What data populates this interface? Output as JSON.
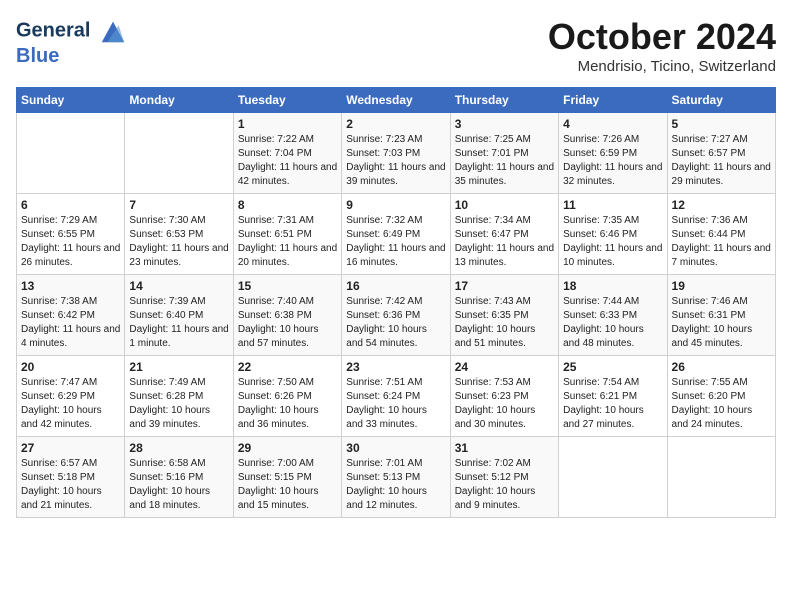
{
  "header": {
    "logo_line1": "General",
    "logo_line2": "Blue",
    "month": "October 2024",
    "location": "Mendrisio, Ticino, Switzerland"
  },
  "days_of_week": [
    "Sunday",
    "Monday",
    "Tuesday",
    "Wednesday",
    "Thursday",
    "Friday",
    "Saturday"
  ],
  "weeks": [
    [
      {
        "day": "",
        "sunrise": "",
        "sunset": "",
        "daylight": ""
      },
      {
        "day": "",
        "sunrise": "",
        "sunset": "",
        "daylight": ""
      },
      {
        "day": "1",
        "sunrise": "Sunrise: 7:22 AM",
        "sunset": "Sunset: 7:04 PM",
        "daylight": "Daylight: 11 hours and 42 minutes."
      },
      {
        "day": "2",
        "sunrise": "Sunrise: 7:23 AM",
        "sunset": "Sunset: 7:03 PM",
        "daylight": "Daylight: 11 hours and 39 minutes."
      },
      {
        "day": "3",
        "sunrise": "Sunrise: 7:25 AM",
        "sunset": "Sunset: 7:01 PM",
        "daylight": "Daylight: 11 hours and 35 minutes."
      },
      {
        "day": "4",
        "sunrise": "Sunrise: 7:26 AM",
        "sunset": "Sunset: 6:59 PM",
        "daylight": "Daylight: 11 hours and 32 minutes."
      },
      {
        "day": "5",
        "sunrise": "Sunrise: 7:27 AM",
        "sunset": "Sunset: 6:57 PM",
        "daylight": "Daylight: 11 hours and 29 minutes."
      }
    ],
    [
      {
        "day": "6",
        "sunrise": "Sunrise: 7:29 AM",
        "sunset": "Sunset: 6:55 PM",
        "daylight": "Daylight: 11 hours and 26 minutes."
      },
      {
        "day": "7",
        "sunrise": "Sunrise: 7:30 AM",
        "sunset": "Sunset: 6:53 PM",
        "daylight": "Daylight: 11 hours and 23 minutes."
      },
      {
        "day": "8",
        "sunrise": "Sunrise: 7:31 AM",
        "sunset": "Sunset: 6:51 PM",
        "daylight": "Daylight: 11 hours and 20 minutes."
      },
      {
        "day": "9",
        "sunrise": "Sunrise: 7:32 AM",
        "sunset": "Sunset: 6:49 PM",
        "daylight": "Daylight: 11 hours and 16 minutes."
      },
      {
        "day": "10",
        "sunrise": "Sunrise: 7:34 AM",
        "sunset": "Sunset: 6:47 PM",
        "daylight": "Daylight: 11 hours and 13 minutes."
      },
      {
        "day": "11",
        "sunrise": "Sunrise: 7:35 AM",
        "sunset": "Sunset: 6:46 PM",
        "daylight": "Daylight: 11 hours and 10 minutes."
      },
      {
        "day": "12",
        "sunrise": "Sunrise: 7:36 AM",
        "sunset": "Sunset: 6:44 PM",
        "daylight": "Daylight: 11 hours and 7 minutes."
      }
    ],
    [
      {
        "day": "13",
        "sunrise": "Sunrise: 7:38 AM",
        "sunset": "Sunset: 6:42 PM",
        "daylight": "Daylight: 11 hours and 4 minutes."
      },
      {
        "day": "14",
        "sunrise": "Sunrise: 7:39 AM",
        "sunset": "Sunset: 6:40 PM",
        "daylight": "Daylight: 11 hours and 1 minute."
      },
      {
        "day": "15",
        "sunrise": "Sunrise: 7:40 AM",
        "sunset": "Sunset: 6:38 PM",
        "daylight": "Daylight: 10 hours and 57 minutes."
      },
      {
        "day": "16",
        "sunrise": "Sunrise: 7:42 AM",
        "sunset": "Sunset: 6:36 PM",
        "daylight": "Daylight: 10 hours and 54 minutes."
      },
      {
        "day": "17",
        "sunrise": "Sunrise: 7:43 AM",
        "sunset": "Sunset: 6:35 PM",
        "daylight": "Daylight: 10 hours and 51 minutes."
      },
      {
        "day": "18",
        "sunrise": "Sunrise: 7:44 AM",
        "sunset": "Sunset: 6:33 PM",
        "daylight": "Daylight: 10 hours and 48 minutes."
      },
      {
        "day": "19",
        "sunrise": "Sunrise: 7:46 AM",
        "sunset": "Sunset: 6:31 PM",
        "daylight": "Daylight: 10 hours and 45 minutes."
      }
    ],
    [
      {
        "day": "20",
        "sunrise": "Sunrise: 7:47 AM",
        "sunset": "Sunset: 6:29 PM",
        "daylight": "Daylight: 10 hours and 42 minutes."
      },
      {
        "day": "21",
        "sunrise": "Sunrise: 7:49 AM",
        "sunset": "Sunset: 6:28 PM",
        "daylight": "Daylight: 10 hours and 39 minutes."
      },
      {
        "day": "22",
        "sunrise": "Sunrise: 7:50 AM",
        "sunset": "Sunset: 6:26 PM",
        "daylight": "Daylight: 10 hours and 36 minutes."
      },
      {
        "day": "23",
        "sunrise": "Sunrise: 7:51 AM",
        "sunset": "Sunset: 6:24 PM",
        "daylight": "Daylight: 10 hours and 33 minutes."
      },
      {
        "day": "24",
        "sunrise": "Sunrise: 7:53 AM",
        "sunset": "Sunset: 6:23 PM",
        "daylight": "Daylight: 10 hours and 30 minutes."
      },
      {
        "day": "25",
        "sunrise": "Sunrise: 7:54 AM",
        "sunset": "Sunset: 6:21 PM",
        "daylight": "Daylight: 10 hours and 27 minutes."
      },
      {
        "day": "26",
        "sunrise": "Sunrise: 7:55 AM",
        "sunset": "Sunset: 6:20 PM",
        "daylight": "Daylight: 10 hours and 24 minutes."
      }
    ],
    [
      {
        "day": "27",
        "sunrise": "Sunrise: 6:57 AM",
        "sunset": "Sunset: 5:18 PM",
        "daylight": "Daylight: 10 hours and 21 minutes."
      },
      {
        "day": "28",
        "sunrise": "Sunrise: 6:58 AM",
        "sunset": "Sunset: 5:16 PM",
        "daylight": "Daylight: 10 hours and 18 minutes."
      },
      {
        "day": "29",
        "sunrise": "Sunrise: 7:00 AM",
        "sunset": "Sunset: 5:15 PM",
        "daylight": "Daylight: 10 hours and 15 minutes."
      },
      {
        "day": "30",
        "sunrise": "Sunrise: 7:01 AM",
        "sunset": "Sunset: 5:13 PM",
        "daylight": "Daylight: 10 hours and 12 minutes."
      },
      {
        "day": "31",
        "sunrise": "Sunrise: 7:02 AM",
        "sunset": "Sunset: 5:12 PM",
        "daylight": "Daylight: 10 hours and 9 minutes."
      },
      {
        "day": "",
        "sunrise": "",
        "sunset": "",
        "daylight": ""
      },
      {
        "day": "",
        "sunrise": "",
        "sunset": "",
        "daylight": ""
      }
    ]
  ]
}
